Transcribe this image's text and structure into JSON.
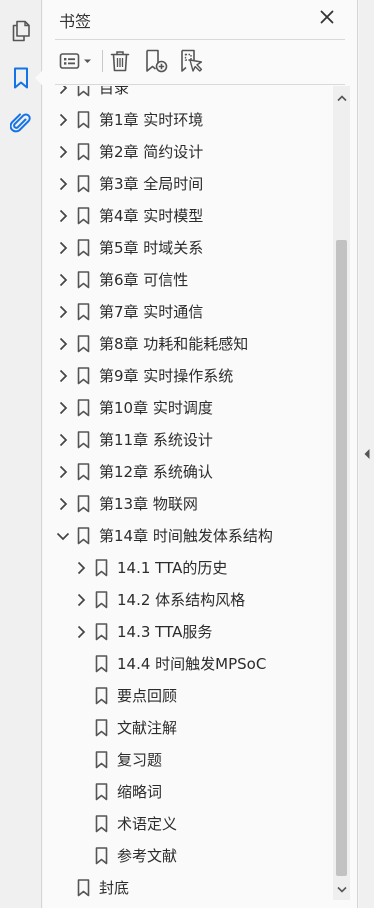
{
  "panel": {
    "title": "书签"
  },
  "tree": {
    "clipped_top_label": "目录",
    "items": [
      {
        "label": "第1章  实时环境",
        "expandable": true,
        "expanded": false,
        "level": 0
      },
      {
        "label": "第2章  简约设计",
        "expandable": true,
        "expanded": false,
        "level": 0
      },
      {
        "label": "第3章  全局时间",
        "expandable": true,
        "expanded": false,
        "level": 0
      },
      {
        "label": "第4章  实时模型",
        "expandable": true,
        "expanded": false,
        "level": 0
      },
      {
        "label": "第5章  时域关系",
        "expandable": true,
        "expanded": false,
        "level": 0
      },
      {
        "label": "第6章  可信性",
        "expandable": true,
        "expanded": false,
        "level": 0
      },
      {
        "label": "第7章  实时通信",
        "expandable": true,
        "expanded": false,
        "level": 0
      },
      {
        "label": "第8章  功耗和能耗感知",
        "expandable": true,
        "expanded": false,
        "level": 0
      },
      {
        "label": "第9章  实时操作系统",
        "expandable": true,
        "expanded": false,
        "level": 0
      },
      {
        "label": "第10章  实时调度",
        "expandable": true,
        "expanded": false,
        "level": 0
      },
      {
        "label": "第11章  系统设计",
        "expandable": true,
        "expanded": false,
        "level": 0
      },
      {
        "label": "第12章  系统确认",
        "expandable": true,
        "expanded": false,
        "level": 0
      },
      {
        "label": "第13章  物联网",
        "expandable": true,
        "expanded": false,
        "level": 0
      },
      {
        "label": "第14章  时间触发体系结构",
        "expandable": true,
        "expanded": true,
        "level": 0
      },
      {
        "label": "14.1 TTA的历史",
        "expandable": true,
        "expanded": false,
        "level": 1
      },
      {
        "label": "14.2 体系结构风格",
        "expandable": true,
        "expanded": false,
        "level": 1
      },
      {
        "label": "14.3 TTA服务",
        "expandable": true,
        "expanded": false,
        "level": 1
      },
      {
        "label": "14.4 时间触发MPSoC",
        "expandable": false,
        "expanded": false,
        "level": 1
      },
      {
        "label": "要点回顾",
        "expandable": false,
        "expanded": false,
        "level": 1
      },
      {
        "label": "文献注解",
        "expandable": false,
        "expanded": false,
        "level": 1
      },
      {
        "label": "复习题",
        "expandable": false,
        "expanded": false,
        "level": 1
      },
      {
        "label": "缩略词",
        "expandable": false,
        "expanded": false,
        "level": 1
      },
      {
        "label": "术语定义",
        "expandable": false,
        "expanded": false,
        "level": 1
      },
      {
        "label": "参考文献",
        "expandable": false,
        "expanded": false,
        "level": 1
      },
      {
        "label": "封底",
        "expandable": false,
        "expanded": false,
        "level": 0
      }
    ]
  },
  "colors": {
    "accent": "#1473e6",
    "icon": "#555555",
    "panel_bg": "#fafafa"
  },
  "icons": {
    "rail": [
      "pages-icon",
      "bookmark-icon",
      "paperclip-icon"
    ],
    "toolbar": [
      "options-icon",
      "trash-icon",
      "new-bookmark-icon",
      "bookmark-from-selection-icon"
    ]
  }
}
